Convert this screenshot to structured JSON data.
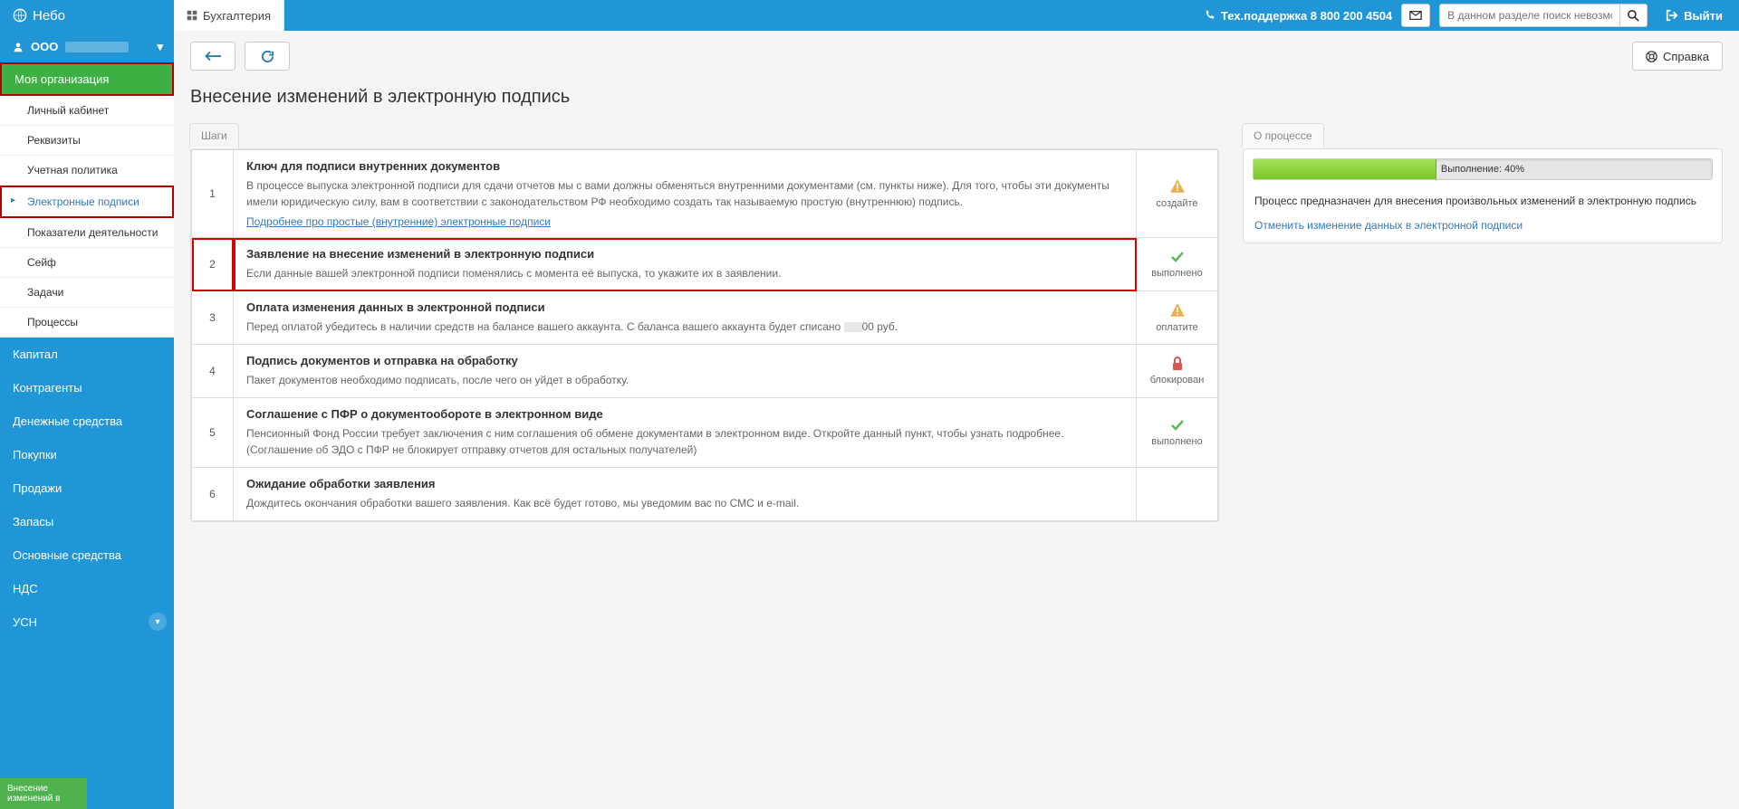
{
  "brand": "Небо",
  "topbar": {
    "tab_label": "Бухгалтерия",
    "support_label": "Тех.поддержка 8 800 200 4504",
    "search_placeholder": "В данном разделе поиск невозможен",
    "logout_label": "Выйти",
    "help_label": "Справка"
  },
  "sidebar": {
    "org_prefix": "ООО",
    "active_section": "Моя организация",
    "sub_items": [
      {
        "label": "Личный кабинет"
      },
      {
        "label": "Реквизиты"
      },
      {
        "label": "Учетная политика"
      },
      {
        "label": "Электронные подписи",
        "active": true
      },
      {
        "label": "Показатели деятельности"
      },
      {
        "label": "Сейф"
      },
      {
        "label": "Задачи"
      },
      {
        "label": "Процессы"
      }
    ],
    "nav_items": [
      "Капитал",
      "Контрагенты",
      "Денежные средства",
      "Покупки",
      "Продажи",
      "Запасы",
      "Основные средства",
      "НДС",
      "УСН"
    ],
    "bottom_tag": "Внесение изменений в"
  },
  "page": {
    "title": "Внесение изменений в электронную подпись",
    "steps_tab": "Шаги",
    "steps": [
      {
        "num": "1",
        "title": "Ключ для подписи внутренних документов",
        "desc": "В процессе выпуска электронной подписи для сдачи отчетов мы с вами должны обменяться внутренними документами (см. пункты ниже). Для того, чтобы эти документы имели юридическую силу, вам в соответствии с законодательством РФ необходимо создать так называемую простую (внутреннюю) подпись.",
        "link": "Подробнее про простые (внутренние) электронные подписи",
        "status": {
          "icon": "warn",
          "label": "создайте"
        }
      },
      {
        "num": "2",
        "title": "Заявление на внесение изменений в электронную подписи",
        "desc": "Если данные вашей электронной подписи поменялись с момента её выпуска, то укажите их в заявлении.",
        "status": {
          "icon": "check",
          "label": "выполнено"
        },
        "highlight": true
      },
      {
        "num": "3",
        "title": "Оплата изменения данных в электронной подписи",
        "desc_prefix": "Перед оплатой убедитесь в наличии средств на балансе вашего аккаунта. С баланса вашего аккаунта будет списано ",
        "desc_suffix": "00 руб.",
        "status": {
          "icon": "warn",
          "label": "оплатите"
        }
      },
      {
        "num": "4",
        "title": "Подпись документов и отправка на обработку",
        "desc": "Пакет документов необходимо подписать, после чего он уйдет в обработку.",
        "status": {
          "icon": "lock",
          "label": "блокирован"
        }
      },
      {
        "num": "5",
        "title": "Соглашение с ПФР о документообороте в электронном виде",
        "desc": "Пенсионный Фонд России требует заключения с ним соглашения об обмене документами в электронном виде. Откройте данный пункт, чтобы узнать подробнее. (Соглашение об ЭДО с ПФР не блокирует отправку отчетов для остальных получателей)",
        "status": {
          "icon": "check",
          "label": "выполнено"
        }
      },
      {
        "num": "6",
        "title": "Ожидание обработки заявления",
        "desc": "Дождитесь окончания обработки вашего заявления. Как всё будет готово, мы уведомим вас по СМС и e-mail.",
        "status": null
      }
    ]
  },
  "process_panel": {
    "tab": "О процессе",
    "progress_pct": 40,
    "progress_label": "Выполнение: 40%",
    "desc": "Процесс предназначен для внесения произвольных изменений в электронную подпись",
    "cancel_link": "Отменить изменение данных в электронной подписи"
  }
}
